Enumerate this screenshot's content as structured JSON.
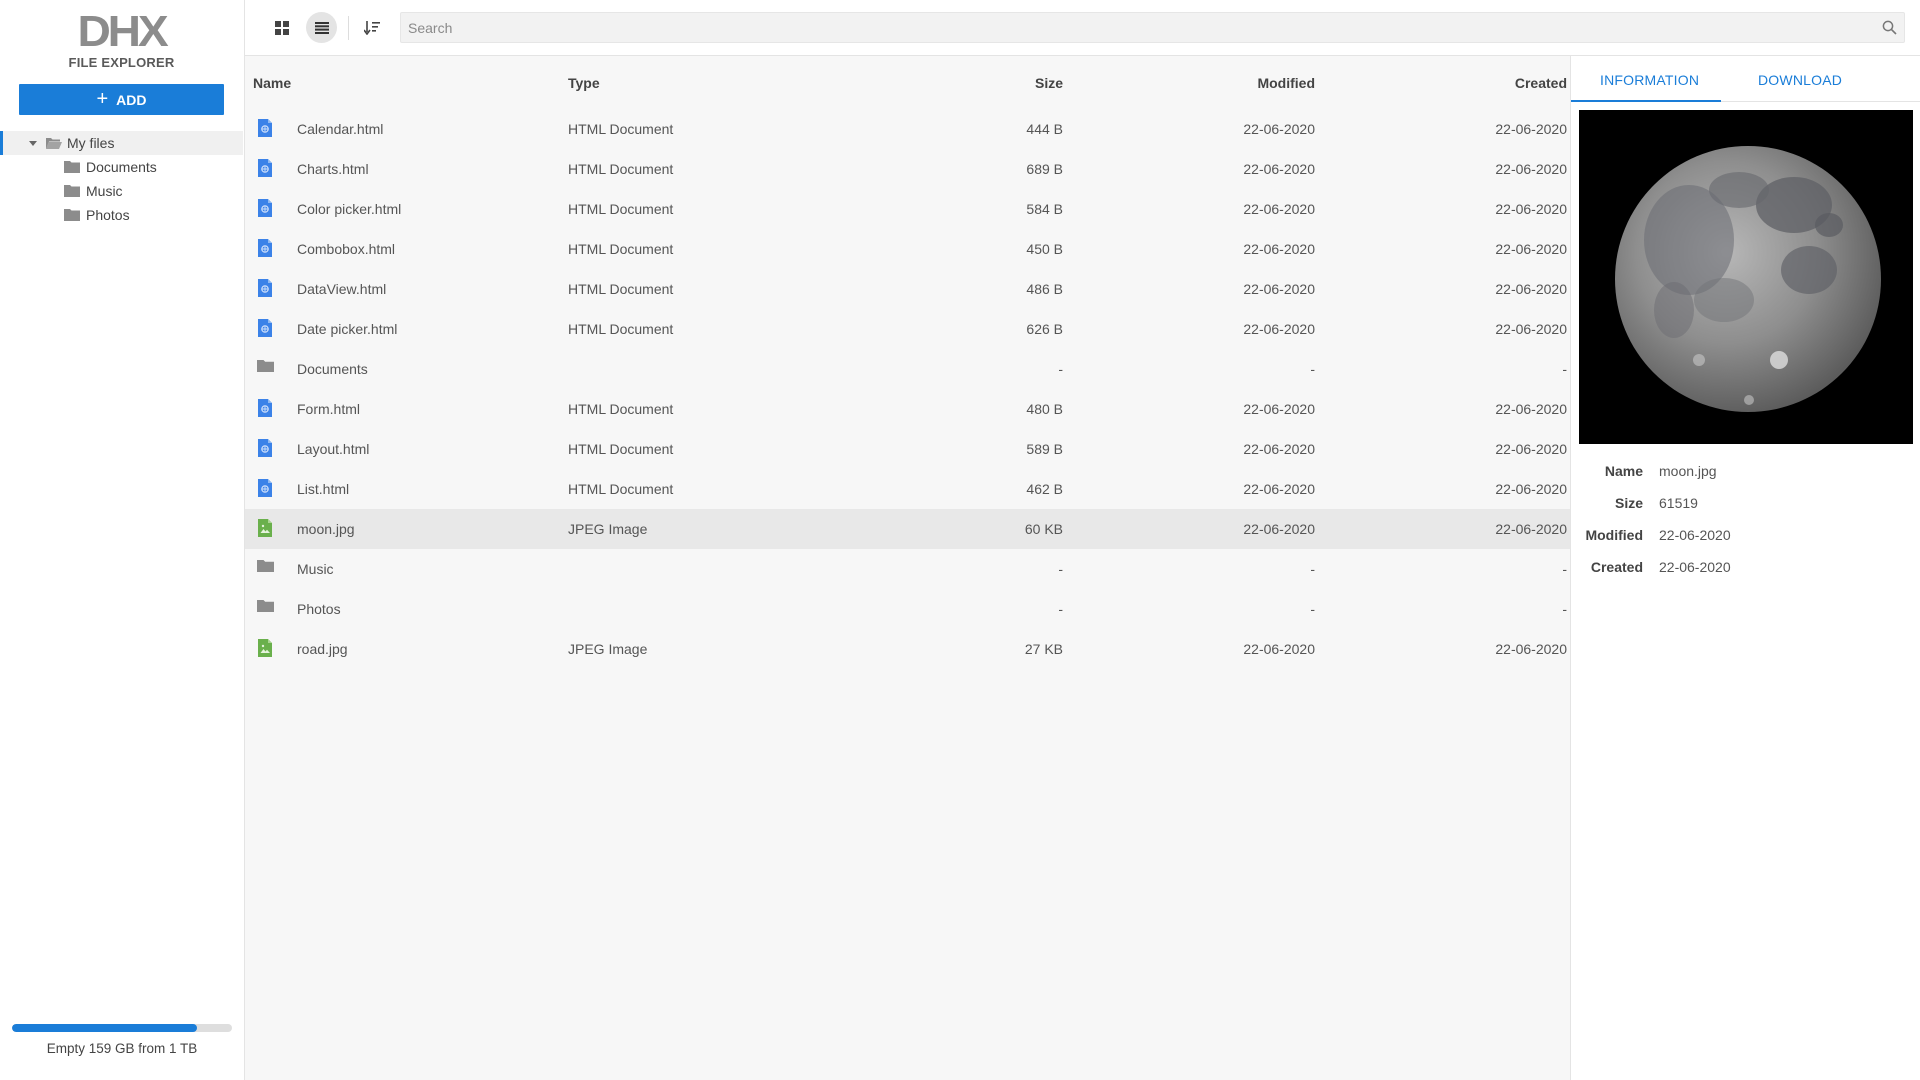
{
  "app": {
    "logo": "DHX",
    "logo_subtitle": "FILE EXPLORER",
    "add_label": "ADD"
  },
  "tree": {
    "root": "My files",
    "children": [
      "Documents",
      "Music",
      "Photos"
    ]
  },
  "storage": {
    "label": "Empty 159 GB from 1 TB",
    "used_fraction": 0.84
  },
  "toolbar": {
    "search_placeholder": "Search",
    "icons": [
      "grid-view-icon",
      "list-view-icon",
      "sort-icon",
      "search-icon"
    ]
  },
  "columns": {
    "name": "Name",
    "type": "Type",
    "size": "Size",
    "modified": "Modified",
    "created": "Created"
  },
  "files": [
    {
      "name": "Calendar.html",
      "type": "HTML Document",
      "size": "444 B",
      "modified": "22-06-2020",
      "created": "22-06-2020",
      "icon": "html"
    },
    {
      "name": "Charts.html",
      "type": "HTML Document",
      "size": "689 B",
      "modified": "22-06-2020",
      "created": "22-06-2020",
      "icon": "html"
    },
    {
      "name": "Color picker.html",
      "type": "HTML Document",
      "size": "584 B",
      "modified": "22-06-2020",
      "created": "22-06-2020",
      "icon": "html"
    },
    {
      "name": "Combobox.html",
      "type": "HTML Document",
      "size": "450 B",
      "modified": "22-06-2020",
      "created": "22-06-2020",
      "icon": "html"
    },
    {
      "name": "DataView.html",
      "type": "HTML Document",
      "size": "486 B",
      "modified": "22-06-2020",
      "created": "22-06-2020",
      "icon": "html"
    },
    {
      "name": "Date picker.html",
      "type": "HTML Document",
      "size": "626 B",
      "modified": "22-06-2020",
      "created": "22-06-2020",
      "icon": "html"
    },
    {
      "name": "Documents",
      "type": "",
      "size": "-",
      "modified": "-",
      "created": "-",
      "icon": "folder"
    },
    {
      "name": "Form.html",
      "type": "HTML Document",
      "size": "480 B",
      "modified": "22-06-2020",
      "created": "22-06-2020",
      "icon": "html"
    },
    {
      "name": "Layout.html",
      "type": "HTML Document",
      "size": "589 B",
      "modified": "22-06-2020",
      "created": "22-06-2020",
      "icon": "html"
    },
    {
      "name": "List.html",
      "type": "HTML Document",
      "size": "462 B",
      "modified": "22-06-2020",
      "created": "22-06-2020",
      "icon": "html"
    },
    {
      "name": "moon.jpg",
      "type": "JPEG Image",
      "size": "60 KB",
      "modified": "22-06-2020",
      "created": "22-06-2020",
      "icon": "image",
      "selected": true
    },
    {
      "name": "Music",
      "type": "",
      "size": "-",
      "modified": "-",
      "created": "-",
      "icon": "folder"
    },
    {
      "name": "Photos",
      "type": "",
      "size": "-",
      "modified": "-",
      "created": "-",
      "icon": "folder"
    },
    {
      "name": "road.jpg",
      "type": "JPEG Image",
      "size": "27 KB",
      "modified": "22-06-2020",
      "created": "22-06-2020",
      "icon": "image"
    }
  ],
  "panel": {
    "tabs": [
      "INFORMATION",
      "DOWNLOAD"
    ],
    "active_tab": "INFORMATION",
    "info": [
      {
        "key": "Name",
        "value": "moon.jpg"
      },
      {
        "key": "Size",
        "value": "61519"
      },
      {
        "key": "Modified",
        "value": "22-06-2020"
      },
      {
        "key": "Created",
        "value": "22-06-2020"
      }
    ]
  },
  "colors": {
    "accent": "#1a7dd8",
    "html_icon": "#3b82e8",
    "image_icon": "#6ab04c",
    "folder_icon": "#8c8c8c"
  }
}
